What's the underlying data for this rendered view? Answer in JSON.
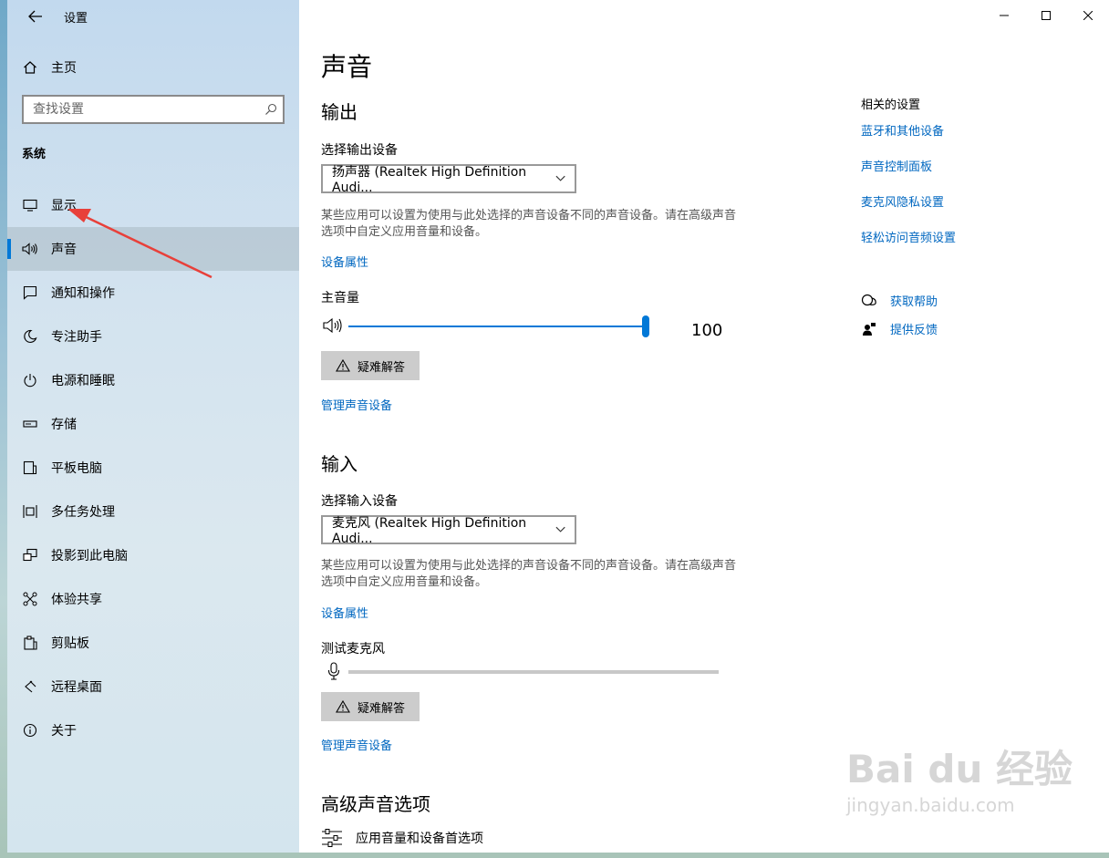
{
  "window": {
    "title": "设置"
  },
  "sidebar": {
    "home_label": "主页",
    "search_placeholder": "查找设置",
    "section_title": "系统",
    "items": [
      {
        "label": "显示",
        "icon": "monitor-icon"
      },
      {
        "label": "声音",
        "icon": "speaker-icon"
      },
      {
        "label": "通知和操作",
        "icon": "notification-icon"
      },
      {
        "label": "专注助手",
        "icon": "moon-icon"
      },
      {
        "label": "电源和睡眠",
        "icon": "power-icon"
      },
      {
        "label": "存储",
        "icon": "storage-icon"
      },
      {
        "label": "平板电脑",
        "icon": "tablet-icon"
      },
      {
        "label": "多任务处理",
        "icon": "multitask-icon"
      },
      {
        "label": "投影到此电脑",
        "icon": "project-icon"
      },
      {
        "label": "体验共享",
        "icon": "share-icon"
      },
      {
        "label": "剪贴板",
        "icon": "clipboard-icon"
      },
      {
        "label": "远程桌面",
        "icon": "remote-desktop-icon"
      },
      {
        "label": "关于",
        "icon": "info-icon"
      }
    ],
    "active_index": 1
  },
  "main": {
    "title": "声音",
    "output": {
      "heading": "输出",
      "select_label": "选择输出设备",
      "device_value": "扬声器 (Realtek High Definition Audi...",
      "description": "某些应用可以设置为使用与此处选择的声音设备不同的声音设备。请在高级声音选项中自定义应用音量和设备。",
      "properties_link": "设备属性",
      "volume_label": "主音量",
      "volume_value": "100",
      "volume_level": 1.0,
      "troubleshoot_label": "疑难解答",
      "manage_link": "管理声音设备"
    },
    "input": {
      "heading": "输入",
      "select_label": "选择输入设备",
      "device_value": "麦克风 (Realtek High Definition Audi...",
      "description": "某些应用可以设置为使用与此处选择的声音设备不同的声音设备。请在高级声音选项中自定义应用音量和设备。",
      "properties_link": "设备属性",
      "test_label": "测试麦克风",
      "mic_level": 0.0,
      "troubleshoot_label": "疑难解答",
      "manage_link": "管理声音设备"
    },
    "advanced": {
      "heading": "高级声音选项",
      "app_volume_label": "应用音量和设备首选项"
    }
  },
  "related": {
    "heading": "相关的设置",
    "links": [
      "蓝牙和其他设备",
      "声音控制面板",
      "麦克风隐私设置",
      "轻松访问音频设置"
    ]
  },
  "help": {
    "get_help": "获取帮助",
    "feedback": "提供反馈"
  },
  "watermark": {
    "brand": "Bai du 经验",
    "url": "jingyan.baidu.com"
  },
  "colors": {
    "accent": "#0078d7",
    "link": "#0067c0",
    "annotation_arrow": "#e8403a"
  }
}
